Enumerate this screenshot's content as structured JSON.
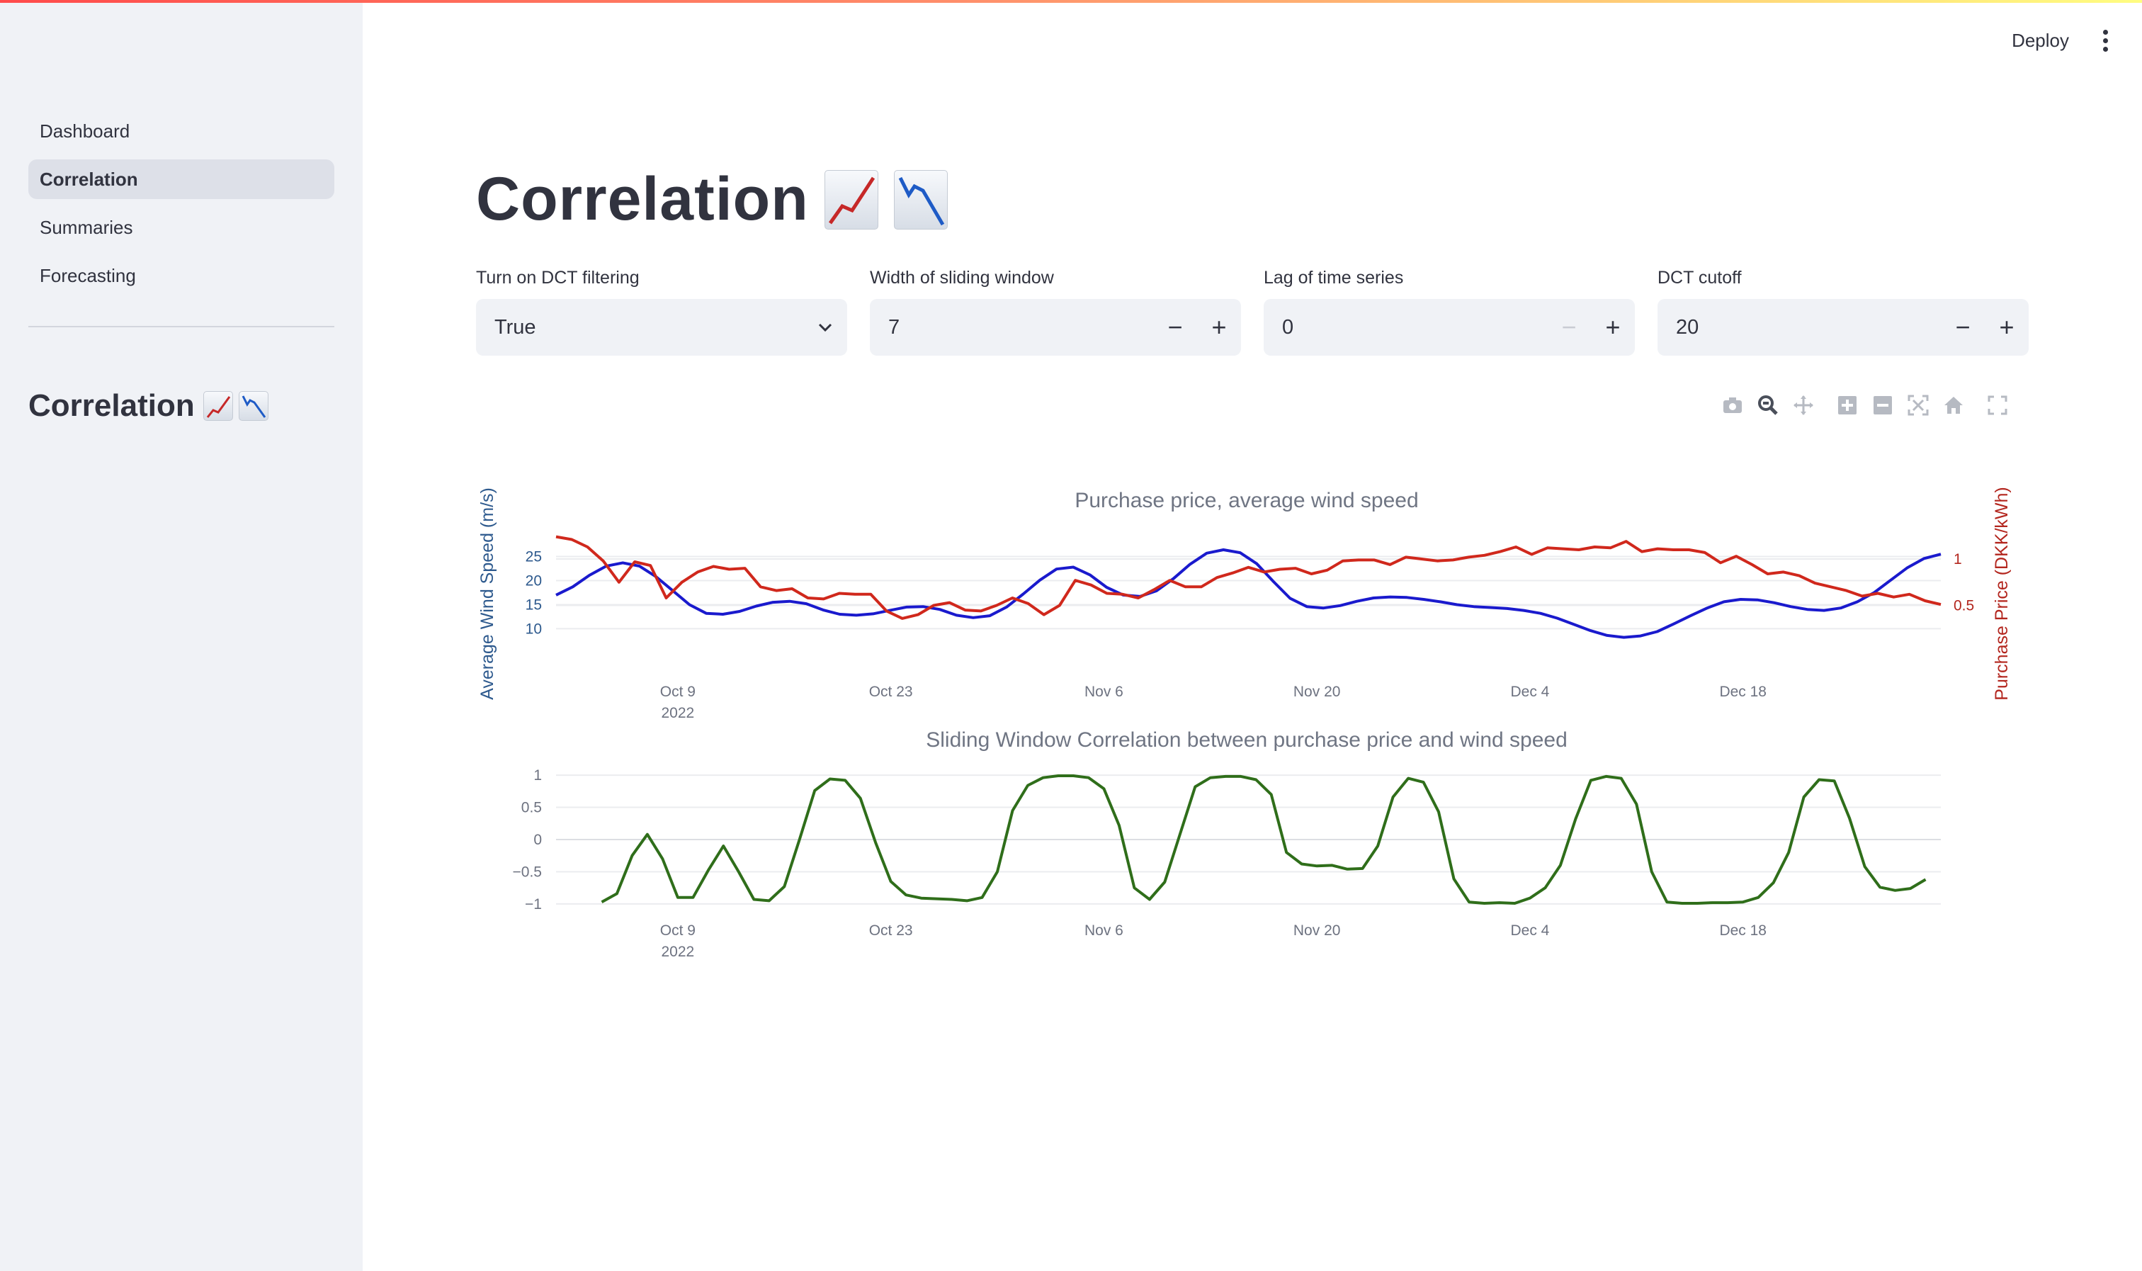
{
  "app": {
    "deploy_label": "Deploy",
    "menu_icon": "kebab-menu-icon",
    "accent_bar_colors": [
      "#ff4b4b",
      "#fffd80"
    ]
  },
  "sidebar": {
    "items": [
      {
        "label": "Dashboard",
        "active": false
      },
      {
        "label": "Correlation",
        "active": true
      },
      {
        "label": "Summaries",
        "active": false
      },
      {
        "label": "Forecasting",
        "active": false
      }
    ],
    "title": "Correlation",
    "title_icons": [
      "chart-increasing-icon",
      "chart-decreasing-icon"
    ]
  },
  "main": {
    "title": "Correlation",
    "title_icons": [
      "chart-increasing-icon",
      "chart-decreasing-icon"
    ],
    "controls": {
      "dct_filter": {
        "label": "Turn on DCT filtering",
        "value": "True",
        "icon": "chevron-down-icon"
      },
      "window_width": {
        "label": "Width of sliding window",
        "value": "7",
        "minus": "−",
        "plus": "+"
      },
      "lag": {
        "label": "Lag of time series",
        "value": "0",
        "minus": "−",
        "plus": "+",
        "minus_disabled": true
      },
      "dct_cutoff": {
        "label": "DCT cutoff",
        "value": "20",
        "minus": "−",
        "plus": "+"
      }
    },
    "modebar_icons": [
      "camera-icon",
      "zoom-icon",
      "pan-icon",
      "zoom-in-icon",
      "zoom-out-icon",
      "autoscale-icon",
      "reset-axes-icon",
      "fullscreen-icon"
    ]
  },
  "chart_data": [
    {
      "type": "line",
      "title": "Purchase price, average wind speed",
      "x_start": "2022-10-01",
      "x_ticks": [
        "Oct 9",
        "Oct 23",
        "Nov 6",
        "Nov 20",
        "Dec 4",
        "Dec 18"
      ],
      "x_tick_subtitle": "2022",
      "ylabel_left": "Average Wind Speed (m/s)",
      "ylabel_right": "Purchase Price (DKK/kWh)",
      "yticks_left": [
        "10",
        "15",
        "20",
        "25"
      ],
      "yticks_right": [
        "0.5",
        "1"
      ],
      "ylim_left": [
        5.2,
        29.5
      ],
      "ylim_right": [
        0.0,
        1.26
      ],
      "grid": true,
      "series": [
        {
          "name": "Average Wind Speed (m/s)",
          "axis": "left",
          "color": "#1a1acd",
          "values": [
            17.0,
            18.7,
            21.1,
            23.0,
            23.7,
            23.0,
            20.8,
            17.9,
            15.0,
            13.2,
            13.0,
            13.6,
            14.7,
            15.5,
            15.7,
            15.2,
            13.9,
            13.0,
            12.8,
            13.1,
            13.8,
            14.5,
            14.6,
            14.0,
            12.8,
            12.3,
            12.7,
            14.5,
            17.2,
            20.1,
            22.4,
            22.8,
            21.2,
            18.6,
            17.0,
            16.7,
            17.9,
            20.4,
            23.4,
            25.7,
            26.4,
            25.8,
            23.5,
            19.8,
            16.3,
            14.6,
            14.3,
            14.8,
            15.7,
            16.4,
            16.6,
            16.5,
            16.1,
            15.6,
            15.0,
            14.6,
            14.4,
            14.2,
            13.8,
            13.2,
            12.2,
            10.9,
            9.6,
            8.6,
            8.2,
            8.5,
            9.4,
            11.0,
            12.7,
            14.3,
            15.6,
            16.1,
            16.0,
            15.4,
            14.6,
            14.0,
            13.8,
            14.3,
            15.6,
            17.5,
            20.1,
            22.7,
            24.6,
            25.5
          ]
        },
        {
          "name": "Purchase Price (DKK/kWh)",
          "axis": "right",
          "color": "#d0281c",
          "values": [
            1.24,
            1.21,
            1.13,
            0.98,
            0.75,
            0.97,
            0.93,
            0.58,
            0.75,
            0.86,
            0.92,
            0.89,
            0.9,
            0.7,
            0.66,
            0.68,
            0.58,
            0.57,
            0.63,
            0.62,
            0.62,
            0.44,
            0.36,
            0.4,
            0.5,
            0.53,
            0.45,
            0.44,
            0.5,
            0.58,
            0.52,
            0.4,
            0.5,
            0.77,
            0.72,
            0.63,
            0.62,
            0.58,
            0.67,
            0.77,
            0.7,
            0.7,
            0.8,
            0.85,
            0.91,
            0.86,
            0.89,
            0.9,
            0.84,
            0.88,
            0.98,
            0.99,
            0.99,
            0.94,
            1.02,
            1.0,
            0.98,
            0.99,
            1.02,
            1.04,
            1.08,
            1.13,
            1.05,
            1.12,
            1.11,
            1.1,
            1.13,
            1.12,
            1.19,
            1.08,
            1.11,
            1.1,
            1.1,
            1.07,
            0.96,
            1.03,
            0.94,
            0.84,
            0.86,
            0.82,
            0.74,
            0.7,
            0.66,
            0.6,
            0.63,
            0.59,
            0.62,
            0.55,
            0.51
          ]
        }
      ]
    },
    {
      "type": "line",
      "title": "Sliding Window Correlation between purchase price and wind speed",
      "x_start": "2022-10-01",
      "x_ticks": [
        "Oct 9",
        "Oct 23",
        "Nov 6",
        "Nov 20",
        "Dec 4",
        "Dec 18"
      ],
      "x_tick_subtitle": "2022",
      "yticks": [
        "1",
        "0.5",
        "0",
        "−0.5",
        "−1"
      ],
      "ylim": [
        -1.1,
        1.1
      ],
      "grid": true,
      "series": [
        {
          "color": "#2f6e1a",
          "x_offset": 3,
          "values": [
            -0.97,
            -0.84,
            -0.25,
            0.08,
            -0.3,
            -0.9,
            -0.9,
            -0.48,
            -0.1,
            -0.5,
            -0.93,
            -0.95,
            -0.73,
            0.0,
            0.76,
            0.94,
            0.92,
            0.64,
            -0.05,
            -0.65,
            -0.86,
            -0.91,
            -0.92,
            -0.93,
            -0.95,
            -0.9,
            -0.5,
            0.45,
            0.84,
            0.96,
            0.99,
            0.99,
            0.96,
            0.79,
            0.22,
            -0.75,
            -0.93,
            -0.66,
            0.08,
            0.82,
            0.96,
            0.98,
            0.98,
            0.93,
            0.7,
            -0.2,
            -0.38,
            -0.41,
            -0.4,
            -0.46,
            -0.45,
            -0.1,
            0.66,
            0.95,
            0.89,
            0.43,
            -0.61,
            -0.97,
            -0.99,
            -0.98,
            -0.99,
            -0.91,
            -0.75,
            -0.4,
            0.32,
            0.92,
            0.98,
            0.95,
            0.55,
            -0.5,
            -0.97,
            -0.99,
            -0.99,
            -0.98,
            -0.98,
            -0.97,
            -0.9,
            -0.67,
            -0.2,
            0.66,
            0.93,
            0.91,
            0.33,
            -0.42,
            -0.74,
            -0.79,
            -0.76,
            -0.62
          ]
        }
      ]
    }
  ]
}
